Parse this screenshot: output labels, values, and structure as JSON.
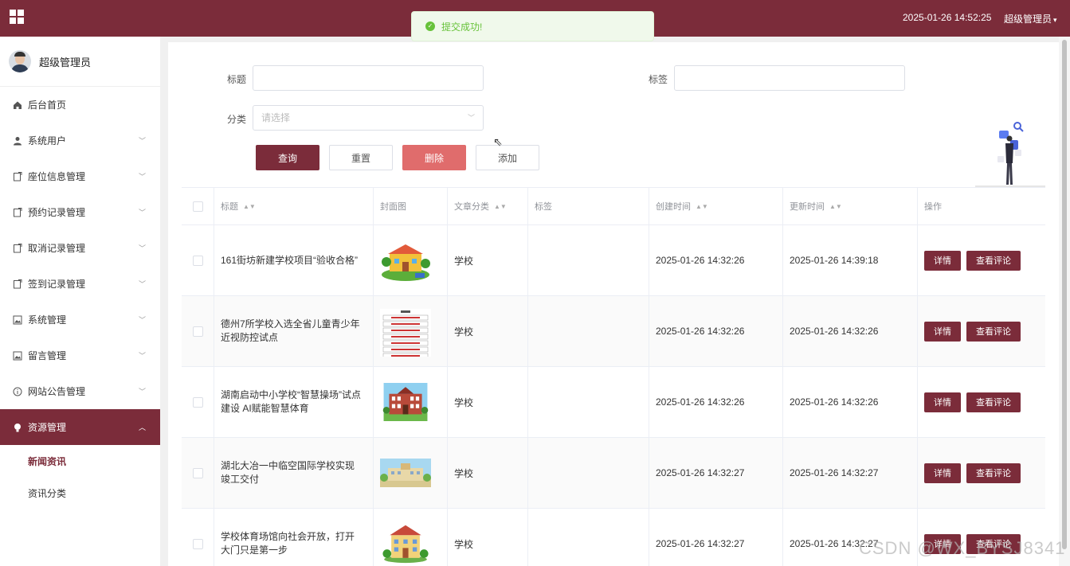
{
  "header": {
    "datetime": "2025-01-26 14:52:25",
    "user": "超级管理员"
  },
  "toast": {
    "message": "提交成功!"
  },
  "sidebar": {
    "profile_name": "超级管理员",
    "items": [
      {
        "label": "后台首页",
        "icon": "home-icon"
      },
      {
        "label": "系统用户",
        "icon": "user-icon"
      },
      {
        "label": "座位信息管理",
        "icon": "doc-icon"
      },
      {
        "label": "预约记录管理",
        "icon": "doc-icon"
      },
      {
        "label": "取消记录管理",
        "icon": "doc-icon"
      },
      {
        "label": "签到记录管理",
        "icon": "doc-icon"
      },
      {
        "label": "系统管理",
        "icon": "picture-icon"
      },
      {
        "label": "留言管理",
        "icon": "picture-icon"
      },
      {
        "label": "网站公告管理",
        "icon": "info-icon"
      },
      {
        "label": "资源管理",
        "icon": "bulb-icon"
      }
    ],
    "sub_items": [
      "新闻资讯",
      "资讯分类"
    ]
  },
  "filters": {
    "title_label": "标题",
    "tag_label": "标签",
    "category_label": "分类",
    "category_placeholder": "请选择",
    "query_label": "查询",
    "reset_label": "重置",
    "delete_label": "删除",
    "add_label": "添加"
  },
  "table": {
    "headers": {
      "title": "标题",
      "cover": "封面图",
      "category": "文章分类",
      "tag": "标签",
      "created": "创建时间",
      "updated": "更新时间",
      "ops": "操作"
    },
    "detail_label": "详情",
    "comments_label": "查看评论",
    "rows": [
      {
        "title": "161街坊新建学校项目“验收合格”",
        "category": "学校",
        "tag": "",
        "created": "2025-01-26 14:32:26",
        "updated": "2025-01-26 14:39:18"
      },
      {
        "title": "德州7所学校入选全省儿童青少年近视防控试点",
        "category": "学校",
        "tag": "",
        "created": "2025-01-26 14:32:26",
        "updated": "2025-01-26 14:32:26"
      },
      {
        "title": "湖南启动中小学校“智慧操场”试点建设 AI赋能智慧体育",
        "category": "学校",
        "tag": "",
        "created": "2025-01-26 14:32:26",
        "updated": "2025-01-26 14:32:26"
      },
      {
        "title": "湖北大冶一中临空国际学校实现竣工交付",
        "category": "学校",
        "tag": "",
        "created": "2025-01-26 14:32:27",
        "updated": "2025-01-26 14:32:27"
      },
      {
        "title": "学校体育场馆向社会开放，打开大门只是第一步",
        "category": "学校",
        "tag": "",
        "created": "2025-01-26 14:32:27",
        "updated": "2025-01-26 14:32:27"
      }
    ]
  },
  "watermark": "CSDN @WX_BYSJ8341"
}
